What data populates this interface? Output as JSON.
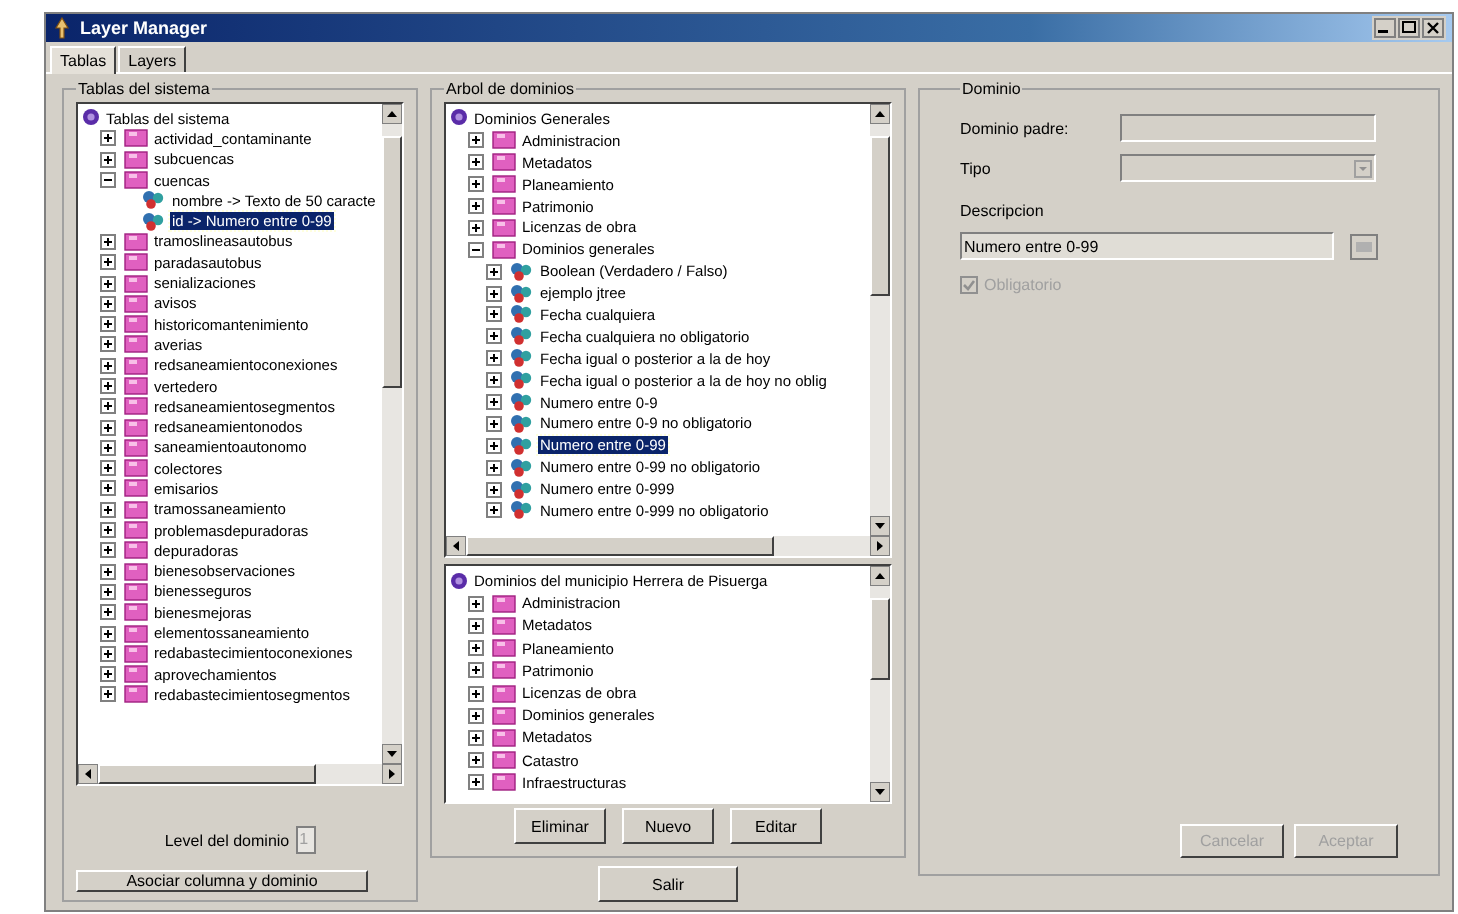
{
  "window": {
    "title": "Layer Manager"
  },
  "tabs": [
    {
      "label": "Tablas",
      "selected": true
    },
    {
      "label": "Layers",
      "selected": false
    }
  ],
  "tables_panel": {
    "title": "Tablas del sistema",
    "tree": [
      {
        "kind": "root",
        "label": "Tablas del sistema",
        "selected": false,
        "children": [
          {
            "kind": "folder",
            "label": "actividad_contaminante",
            "expanded": false,
            "selected": false
          },
          {
            "kind": "folder",
            "label": "subcuencas",
            "expanded": false,
            "selected": false
          },
          {
            "kind": "folder",
            "label": "cuencas",
            "expanded": true,
            "selected": false,
            "children": [
              {
                "kind": "field",
                "label": "nombre  ->  Texto de 50 caracte",
                "selected": false
              },
              {
                "kind": "field",
                "label": "id  ->  Numero entre 0-99",
                "selected": true
              }
            ]
          },
          {
            "kind": "folder",
            "label": "tramoslineasautobus",
            "expanded": false,
            "selected": false
          },
          {
            "kind": "folder",
            "label": "paradasautobus",
            "expanded": false,
            "selected": false
          },
          {
            "kind": "folder",
            "label": "senializaciones",
            "expanded": false,
            "selected": false
          },
          {
            "kind": "folder",
            "label": "avisos",
            "expanded": false,
            "selected": false
          },
          {
            "kind": "folder",
            "label": "historicomantenimiento",
            "expanded": false,
            "selected": false
          },
          {
            "kind": "folder",
            "label": "averias",
            "expanded": false,
            "selected": false
          },
          {
            "kind": "folder",
            "label": "redsaneamientoconexiones",
            "expanded": false,
            "selected": false
          },
          {
            "kind": "folder",
            "label": "vertedero",
            "expanded": false,
            "selected": false
          },
          {
            "kind": "folder",
            "label": "redsaneamientosegmentos",
            "expanded": false,
            "selected": false
          },
          {
            "kind": "folder",
            "label": "redsaneamientonodos",
            "expanded": false,
            "selected": false
          },
          {
            "kind": "folder",
            "label": "saneamientoautonomo",
            "expanded": false,
            "selected": false
          },
          {
            "kind": "folder",
            "label": "colectores",
            "expanded": false,
            "selected": false
          },
          {
            "kind": "folder",
            "label": "emisarios",
            "expanded": false,
            "selected": false
          },
          {
            "kind": "folder",
            "label": "tramossaneamiento",
            "expanded": false,
            "selected": false
          },
          {
            "kind": "folder",
            "label": "problemasdepuradoras",
            "expanded": false,
            "selected": false
          },
          {
            "kind": "folder",
            "label": "depuradoras",
            "expanded": false,
            "selected": false
          },
          {
            "kind": "folder",
            "label": "bienesobservaciones",
            "expanded": false,
            "selected": false
          },
          {
            "kind": "folder",
            "label": "bienesseguros",
            "expanded": false,
            "selected": false
          },
          {
            "kind": "folder",
            "label": "bienesmejoras",
            "expanded": false,
            "selected": false
          },
          {
            "kind": "folder",
            "label": "elementossaneamiento",
            "expanded": false,
            "selected": false
          },
          {
            "kind": "folder",
            "label": "redabastecimientoconexiones",
            "expanded": false,
            "selected": false
          },
          {
            "kind": "folder",
            "label": "aprovechamientos",
            "expanded": false,
            "selected": false
          },
          {
            "kind": "folder",
            "label": "redabastecimientosegmentos",
            "expanded": false,
            "selected": false
          }
        ]
      }
    ],
    "level_label": "Level del dominio",
    "level_value": "1",
    "associate_button": "Asociar columna y dominio"
  },
  "domains_panel": {
    "title": "Arbol de dominios",
    "general_tree": [
      {
        "kind": "root",
        "label": "Dominios Generales",
        "selected": false,
        "children": [
          {
            "kind": "folder",
            "label": "Administracion",
            "expanded": false,
            "selected": false
          },
          {
            "kind": "folder",
            "label": "Metadatos",
            "expanded": false,
            "selected": false
          },
          {
            "kind": "folder",
            "label": "Planeamiento",
            "expanded": false,
            "selected": false
          },
          {
            "kind": "folder",
            "label": "Patrimonio",
            "expanded": false,
            "selected": false
          },
          {
            "kind": "folder",
            "label": "Licenzas de obra",
            "expanded": false,
            "selected": false
          },
          {
            "kind": "folder",
            "label": "Dominios generales",
            "expanded": true,
            "selected": false,
            "children": [
              {
                "kind": "domain",
                "label": "Boolean (Verdadero / Falso)",
                "expanded": false,
                "selected": false
              },
              {
                "kind": "domain",
                "label": "ejemplo jtree",
                "expanded": false,
                "selected": false
              },
              {
                "kind": "domain",
                "label": "Fecha cualquiera",
                "expanded": false,
                "selected": false
              },
              {
                "kind": "domain",
                "label": "Fecha cualquiera no obligatorio",
                "expanded": false,
                "selected": false
              },
              {
                "kind": "domain",
                "label": "Fecha igual o posterior a la de hoy",
                "expanded": false,
                "selected": false
              },
              {
                "kind": "domain",
                "label": "Fecha igual o posterior a la de hoy no oblig",
                "expanded": false,
                "selected": false
              },
              {
                "kind": "domain",
                "label": "Numero entre 0-9",
                "expanded": false,
                "selected": false
              },
              {
                "kind": "domain",
                "label": "Numero entre 0-9 no obligatorio",
                "expanded": false,
                "selected": false
              },
              {
                "kind": "domain",
                "label": "Numero entre 0-99",
                "expanded": false,
                "selected": true
              },
              {
                "kind": "domain",
                "label": "Numero entre 0-99 no obligatorio",
                "expanded": false,
                "selected": false
              },
              {
                "kind": "domain",
                "label": "Numero entre 0-999",
                "expanded": false,
                "selected": false
              },
              {
                "kind": "domain",
                "label": "Numero entre 0-999 no obligatorio",
                "expanded": false,
                "selected": false
              }
            ]
          }
        ]
      }
    ],
    "municipal_tree": [
      {
        "kind": "root",
        "label": "Dominios del municipio Herrera de Pisuerga",
        "selected": false,
        "children": [
          {
            "kind": "folder",
            "label": "Administracion",
            "expanded": false,
            "selected": false
          },
          {
            "kind": "folder",
            "label": "Metadatos",
            "expanded": false,
            "selected": false
          },
          {
            "kind": "folder",
            "label": "Planeamiento",
            "expanded": false,
            "selected": false
          },
          {
            "kind": "folder",
            "label": "Patrimonio",
            "expanded": false,
            "selected": false
          },
          {
            "kind": "folder",
            "label": "Licenzas de obra",
            "expanded": false,
            "selected": false
          },
          {
            "kind": "folder",
            "label": "Dominios generales",
            "expanded": false,
            "selected": false
          },
          {
            "kind": "folder",
            "label": "Metadatos",
            "expanded": false,
            "selected": false
          },
          {
            "kind": "folder",
            "label": "Catastro",
            "expanded": false,
            "selected": false
          },
          {
            "kind": "folder",
            "label": "Infraestructuras",
            "expanded": false,
            "selected": false
          }
        ]
      }
    ],
    "buttons": [
      "Eliminar",
      "Nuevo",
      "Editar"
    ],
    "exit_button": "Salir"
  },
  "domain_panel": {
    "title": "Dominio",
    "parent_label": "Dominio padre:",
    "type_label": "Tipo",
    "description_label": "Descripcion",
    "description_value": "Numero entre 0-99",
    "required": {
      "label": "Obligatorio",
      "checked": true,
      "disabled": true
    },
    "buttons": [
      {
        "label": "Cancelar",
        "disabled": true
      },
      {
        "label": "Aceptar",
        "disabled": true
      }
    ]
  }
}
